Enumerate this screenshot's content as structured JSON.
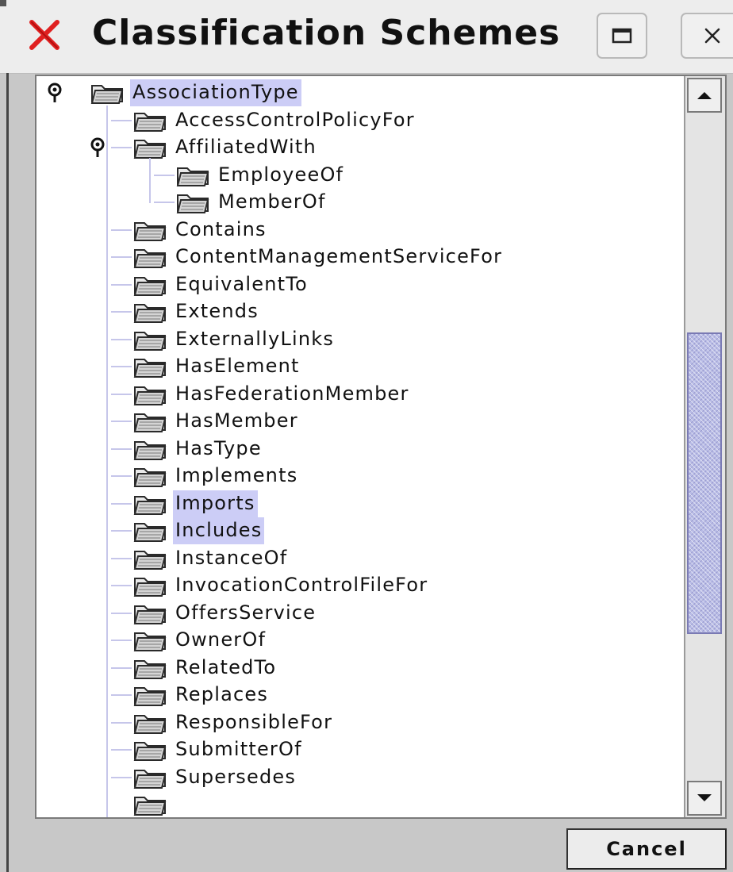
{
  "window": {
    "title": "Classification Schemes",
    "icons": {
      "app": "red-x-icon",
      "maximize": "maximize-icon",
      "close": "close-icon"
    }
  },
  "tree": {
    "icon": "folder-icon",
    "root": {
      "label": "AssociationType",
      "expanded": true,
      "selected": true
    },
    "children": [
      {
        "label": "AccessControlPolicyFor",
        "selected": false
      },
      {
        "label": "AffiliatedWith",
        "expanded": true,
        "selected": false,
        "children": [
          {
            "label": "EmployeeOf",
            "selected": false
          },
          {
            "label": "MemberOf",
            "selected": false
          }
        ]
      },
      {
        "label": "Contains",
        "selected": false
      },
      {
        "label": "ContentManagementServiceFor",
        "selected": false
      },
      {
        "label": "EquivalentTo",
        "selected": false
      },
      {
        "label": "Extends",
        "selected": false
      },
      {
        "label": "ExternallyLinks",
        "selected": false
      },
      {
        "label": "HasElement",
        "selected": false
      },
      {
        "label": "HasFederationMember",
        "selected": false
      },
      {
        "label": "HasMember",
        "selected": false
      },
      {
        "label": "HasType",
        "selected": false
      },
      {
        "label": "Implements",
        "selected": false
      },
      {
        "label": "Imports",
        "selected": true
      },
      {
        "label": "Includes",
        "selected": true
      },
      {
        "label": "InstanceOf",
        "selected": false
      },
      {
        "label": "InvocationControlFileFor",
        "selected": false
      },
      {
        "label": "OffersService",
        "selected": false
      },
      {
        "label": "OwnerOf",
        "selected": false
      },
      {
        "label": "RelatedTo",
        "selected": false
      },
      {
        "label": "Replaces",
        "selected": false
      },
      {
        "label": "ResponsibleFor",
        "selected": false
      },
      {
        "label": "SubmitterOf",
        "selected": false
      },
      {
        "label": "Supersedes",
        "selected": false
      }
    ]
  },
  "scrollbar": {
    "position_fraction": 0.6
  },
  "footer": {
    "cancel_label": "Cancel"
  },
  "colors": {
    "selection": "#cccdf6",
    "tree_lines": "#c6c6ea",
    "scroll_thumb": "#b9bce6",
    "app_icon": "#e02020"
  }
}
